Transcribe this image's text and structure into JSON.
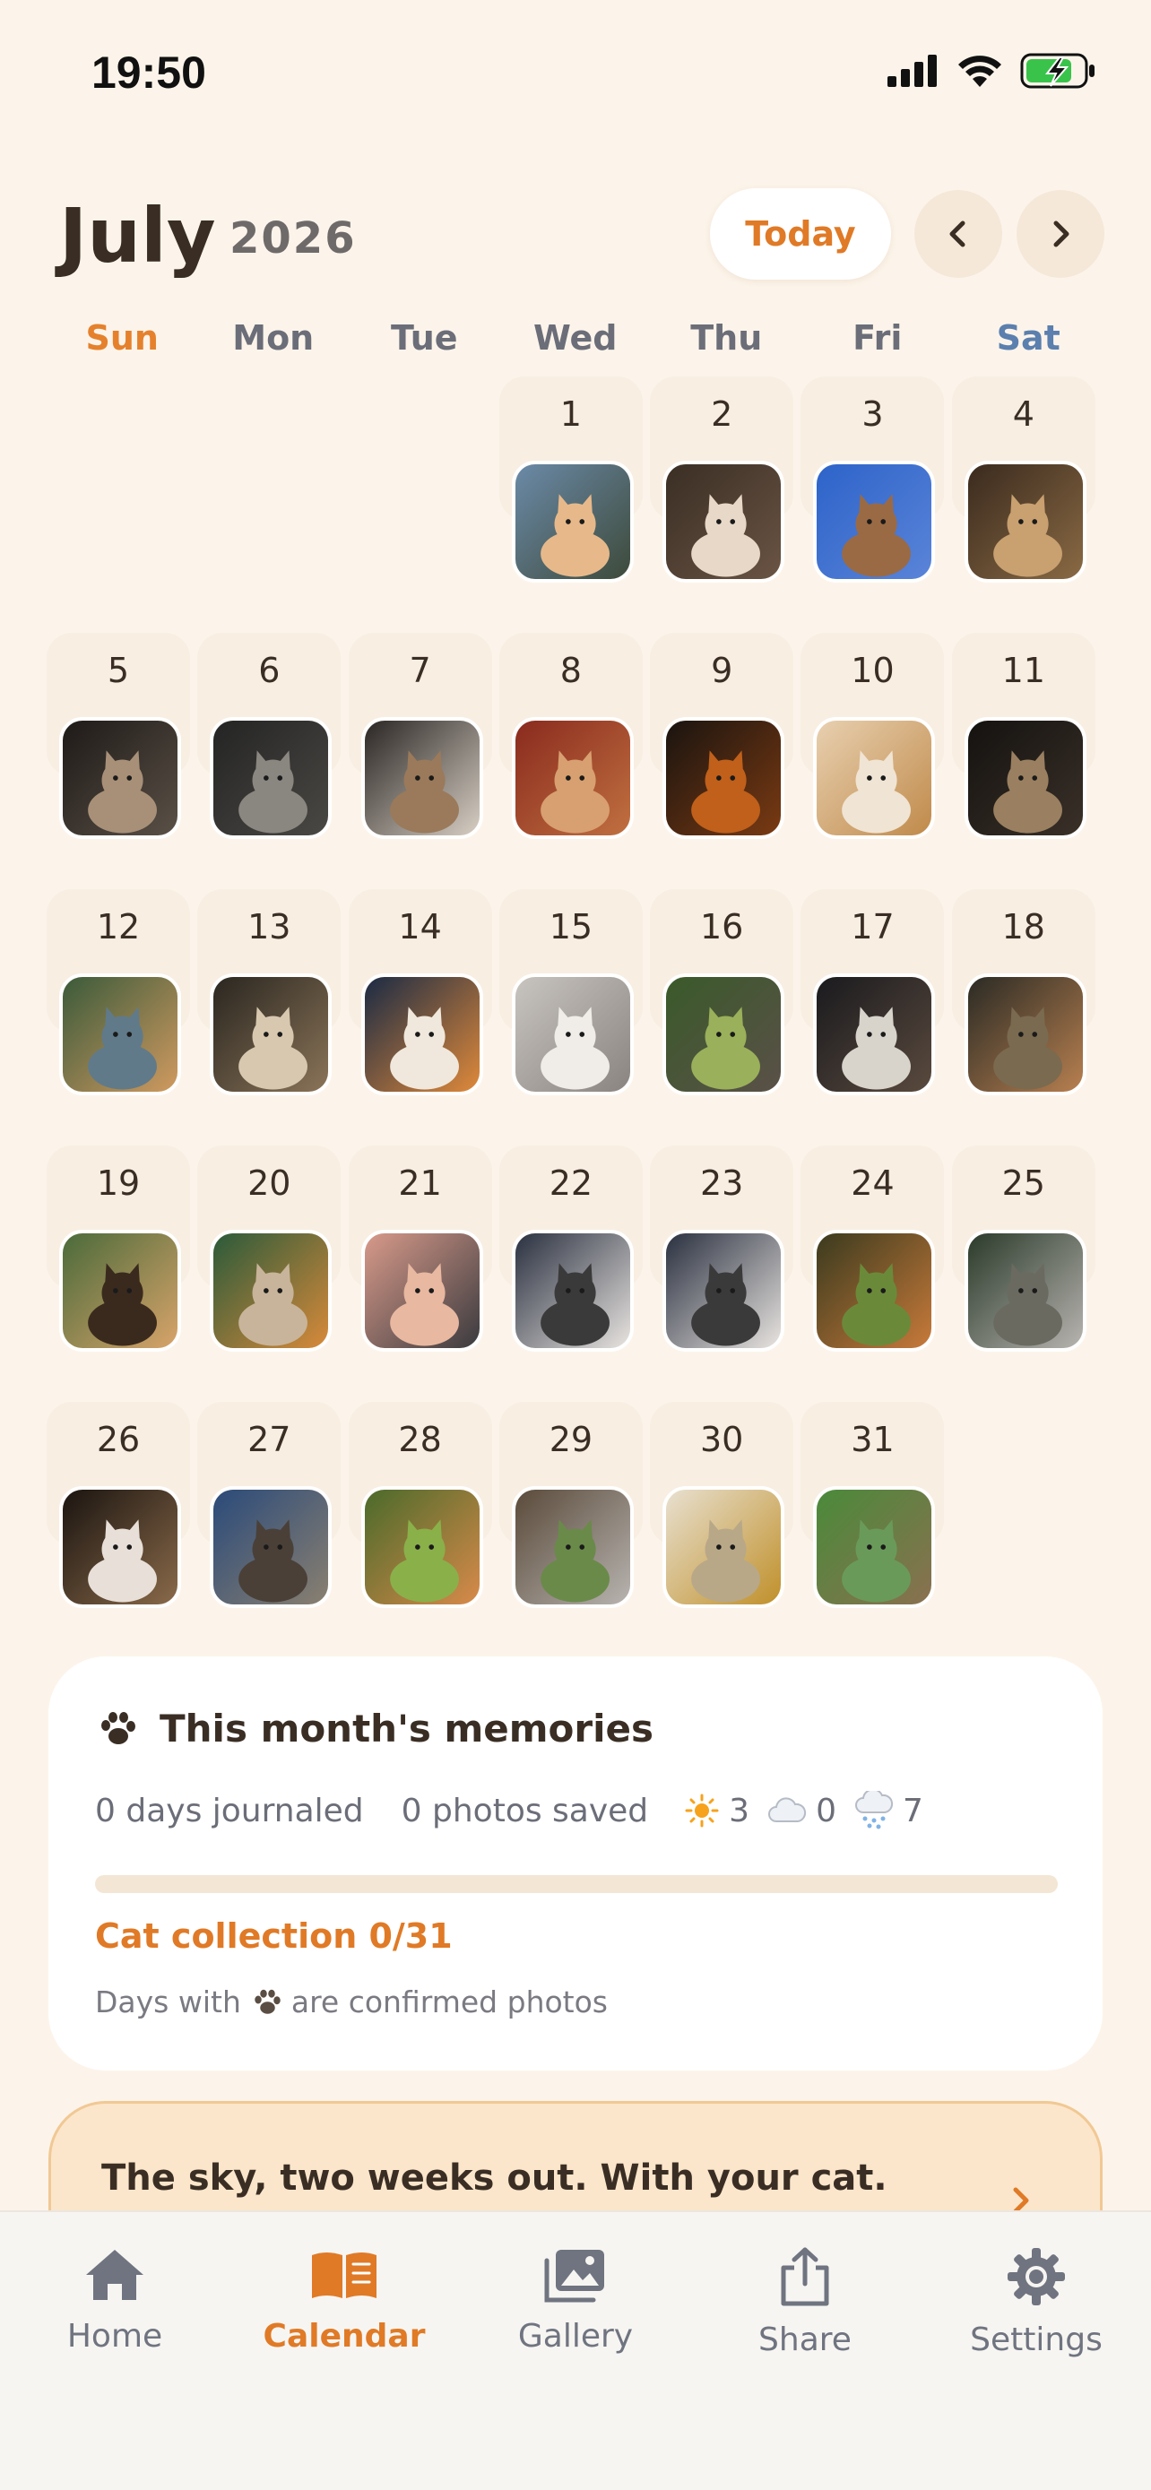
{
  "status_bar": {
    "time": "19:50",
    "icons": [
      "cellular-signal-icon",
      "wifi-icon",
      "battery-charging-icon"
    ]
  },
  "header": {
    "month": "July",
    "year": "2026",
    "today_label": "Today",
    "prev_icon": "chevron-left-icon",
    "next_icon": "chevron-right-icon"
  },
  "weekdays": [
    "Sun",
    "Mon",
    "Tue",
    "Wed",
    "Thu",
    "Fri",
    "Sat"
  ],
  "calendar": {
    "leading_blanks": 3,
    "days": [
      "1",
      "2",
      "3",
      "4",
      "5",
      "6",
      "7",
      "8",
      "9",
      "10",
      "11",
      "12",
      "13",
      "14",
      "15",
      "16",
      "17",
      "18",
      "19",
      "20",
      "21",
      "22",
      "23",
      "24",
      "25",
      "26",
      "27",
      "28",
      "29",
      "30",
      "31"
    ]
  },
  "memories": {
    "title": "This month's memories",
    "days_journaled": "0 days journaled",
    "photos_saved": "0 photos saved",
    "sunny_count": "3",
    "cloudy_count": "0",
    "snowy_count": "7",
    "collection_label": "Cat collection 0/31",
    "collection_progress": 0,
    "note_prefix": "Days with",
    "note_suffix": "are confirmed photos"
  },
  "promo": {
    "text": "The sky, two weeks out. With your cat."
  },
  "tabs": [
    {
      "label": "Home",
      "icon": "home-icon"
    },
    {
      "label": "Calendar",
      "icon": "calendar-book-icon"
    },
    {
      "label": "Gallery",
      "icon": "gallery-icon"
    },
    {
      "label": "Share",
      "icon": "share-icon"
    },
    {
      "label": "Settings",
      "icon": "gear-icon"
    }
  ],
  "colors": {
    "accent": "#e07a26",
    "background": "#fcf4ea",
    "sunday": "#e5812c",
    "saturday": "#5b7fae"
  }
}
